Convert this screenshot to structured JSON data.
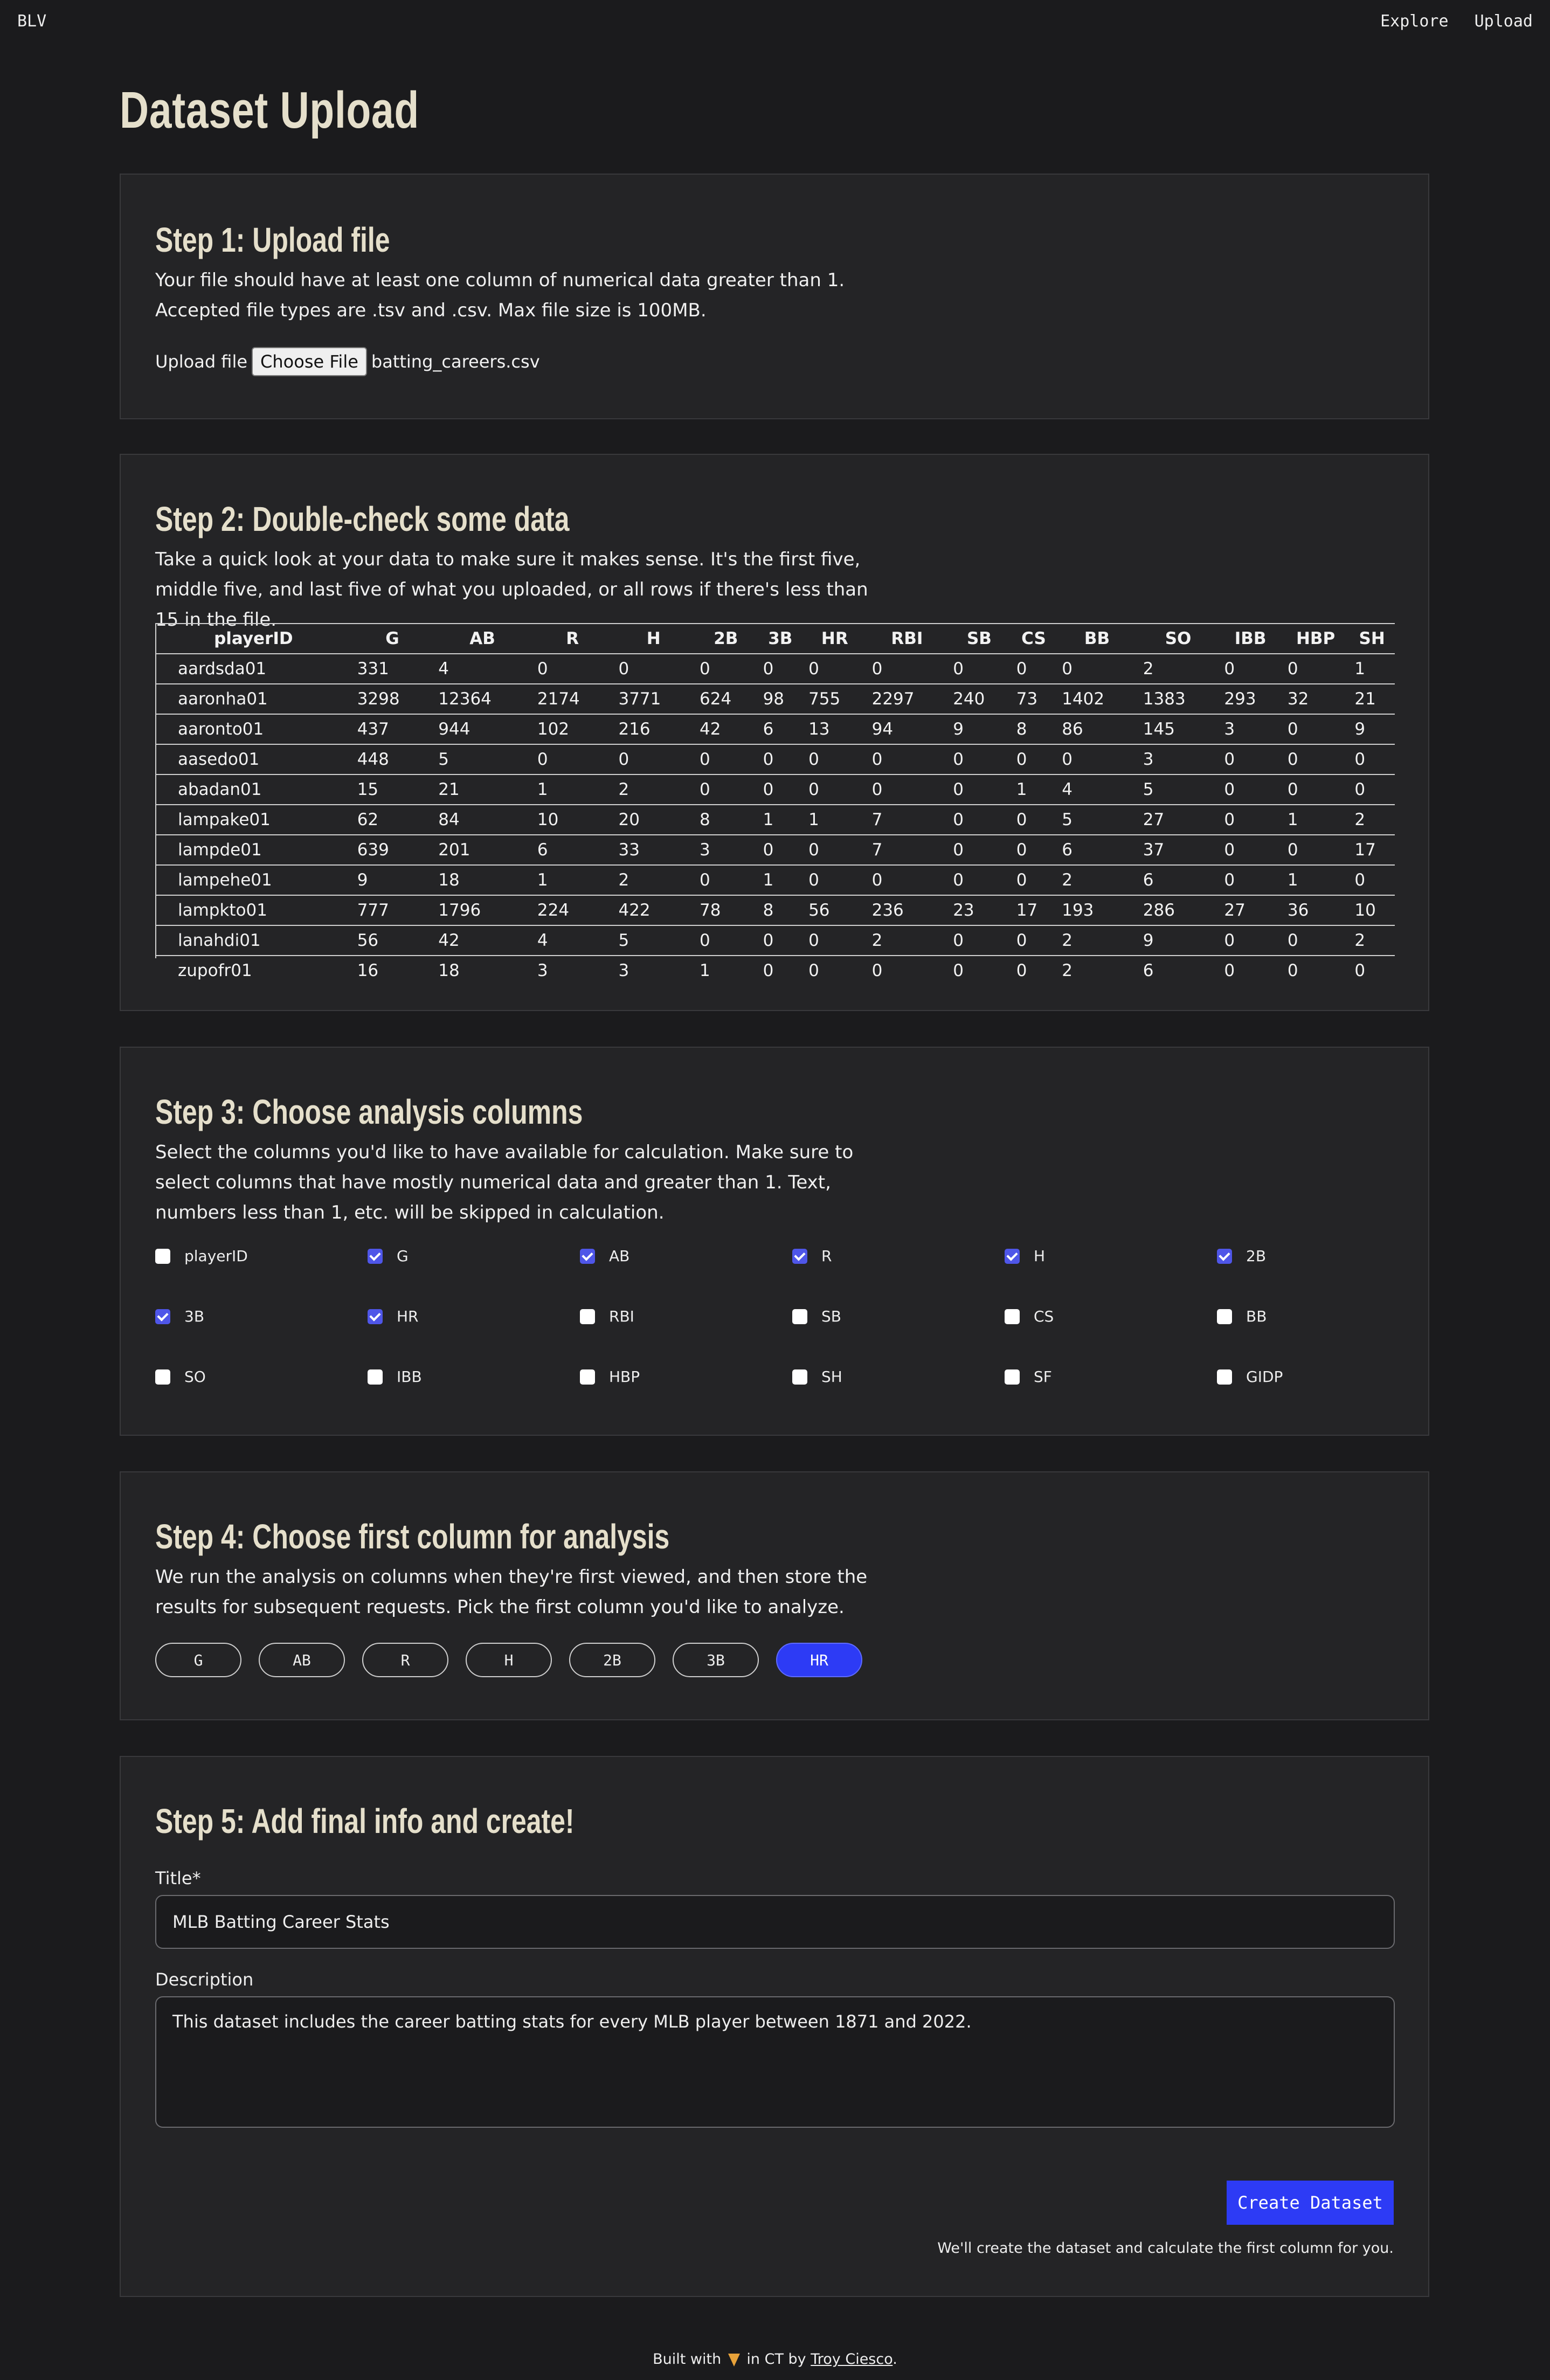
{
  "nav": {
    "brand": "BLV",
    "links": [
      "Explore",
      "Upload"
    ]
  },
  "page_title": "Dataset Upload",
  "step1": {
    "title": "Step 1: Upload file",
    "desc": "Your file should have at least one column of numerical data greater than 1. Accepted file types are .tsv and .csv. Max file size is 100MB.",
    "upload_label": "Upload file",
    "choose_label": "Choose File",
    "file_name": "batting_careers.csv"
  },
  "step2": {
    "title": "Step 2: Double-check some data",
    "desc": "Take a quick look at your data to make sure it makes sense. It's the first five, middle five, and last five of what you uploaded, or all rows if there's less than 15 in the file.",
    "columns": [
      "playerID",
      "G",
      "AB",
      "R",
      "H",
      "2B",
      "3B",
      "HR",
      "RBI",
      "SB",
      "CS",
      "BB",
      "SO",
      "IBB",
      "HBP",
      "SH"
    ],
    "rows": [
      [
        "aardsda01",
        "331",
        "4",
        "0",
        "0",
        "0",
        "0",
        "0",
        "0",
        "0",
        "0",
        "0",
        "2",
        "0",
        "0",
        "1"
      ],
      [
        "aaronha01",
        "3298",
        "12364",
        "2174",
        "3771",
        "624",
        "98",
        "755",
        "2297",
        "240",
        "73",
        "1402",
        "1383",
        "293",
        "32",
        "21"
      ],
      [
        "aaronto01",
        "437",
        "944",
        "102",
        "216",
        "42",
        "6",
        "13",
        "94",
        "9",
        "8",
        "86",
        "145",
        "3",
        "0",
        "9"
      ],
      [
        "aasedo01",
        "448",
        "5",
        "0",
        "0",
        "0",
        "0",
        "0",
        "0",
        "0",
        "0",
        "0",
        "3",
        "0",
        "0",
        "0"
      ],
      [
        "abadan01",
        "15",
        "21",
        "1",
        "2",
        "0",
        "0",
        "0",
        "0",
        "0",
        "1",
        "4",
        "5",
        "0",
        "0",
        "0"
      ],
      [
        "lampake01",
        "62",
        "84",
        "10",
        "20",
        "8",
        "1",
        "1",
        "7",
        "0",
        "0",
        "5",
        "27",
        "0",
        "1",
        "2"
      ],
      [
        "lampde01",
        "639",
        "201",
        "6",
        "33",
        "3",
        "0",
        "0",
        "7",
        "0",
        "0",
        "6",
        "37",
        "0",
        "0",
        "17"
      ],
      [
        "lampehe01",
        "9",
        "18",
        "1",
        "2",
        "0",
        "1",
        "0",
        "0",
        "0",
        "0",
        "2",
        "6",
        "0",
        "1",
        "0"
      ],
      [
        "lampkto01",
        "777",
        "1796",
        "224",
        "422",
        "78",
        "8",
        "56",
        "236",
        "23",
        "17",
        "193",
        "286",
        "27",
        "36",
        "10"
      ],
      [
        "lanahdi01",
        "56",
        "42",
        "4",
        "5",
        "0",
        "0",
        "0",
        "2",
        "0",
        "0",
        "2",
        "9",
        "0",
        "0",
        "2"
      ],
      [
        "zupofr01",
        "16",
        "18",
        "3",
        "3",
        "1",
        "0",
        "0",
        "0",
        "0",
        "0",
        "2",
        "6",
        "0",
        "0",
        "0"
      ]
    ]
  },
  "step3": {
    "title": "Step 3: Choose analysis columns",
    "desc": "Select the columns you'd like to have available for calculation. Make sure to select columns that have mostly numerical data and greater than 1. Text, numbers less than 1, etc. will be skipped in calculation.",
    "options": [
      {
        "label": "playerID",
        "checked": false
      },
      {
        "label": "G",
        "checked": true
      },
      {
        "label": "AB",
        "checked": true
      },
      {
        "label": "R",
        "checked": true
      },
      {
        "label": "H",
        "checked": true
      },
      {
        "label": "2B",
        "checked": true
      },
      {
        "label": "3B",
        "checked": true
      },
      {
        "label": "HR",
        "checked": true
      },
      {
        "label": "RBI",
        "checked": false
      },
      {
        "label": "SB",
        "checked": false
      },
      {
        "label": "CS",
        "checked": false
      },
      {
        "label": "BB",
        "checked": false
      },
      {
        "label": "SO",
        "checked": false
      },
      {
        "label": "IBB",
        "checked": false
      },
      {
        "label": "HBP",
        "checked": false
      },
      {
        "label": "SH",
        "checked": false
      },
      {
        "label": "SF",
        "checked": false
      },
      {
        "label": "GIDP",
        "checked": false
      }
    ]
  },
  "step4": {
    "title": "Step 4: Choose first column for analysis",
    "desc": "We run the analysis on columns when they're first viewed, and then store the results for subsequent requests. Pick the first column you'd like to analyze.",
    "pills": [
      "G",
      "AB",
      "R",
      "H",
      "2B",
      "3B",
      "HR"
    ],
    "selected": "HR"
  },
  "step5": {
    "title": "Step 5: Add final info and create!",
    "title_label": "Title*",
    "title_value": "MLB Batting Career Stats",
    "desc_label": "Description",
    "desc_value": "This dataset includes the career batting stats for every MLB player between 1871 and 2022.",
    "create_label": "Create Dataset",
    "note": "We'll create the dataset and calculate the first column for you."
  },
  "footer": {
    "prefix": "Built with",
    "icon": "pizza-icon",
    "middle": "in CT by",
    "author": "Troy Ciesco",
    "suffix": "."
  },
  "colors": {
    "accent": "#2d3bf5",
    "background": "#1b1b1d",
    "card": "#242426",
    "heading": "#e5dfcb"
  }
}
